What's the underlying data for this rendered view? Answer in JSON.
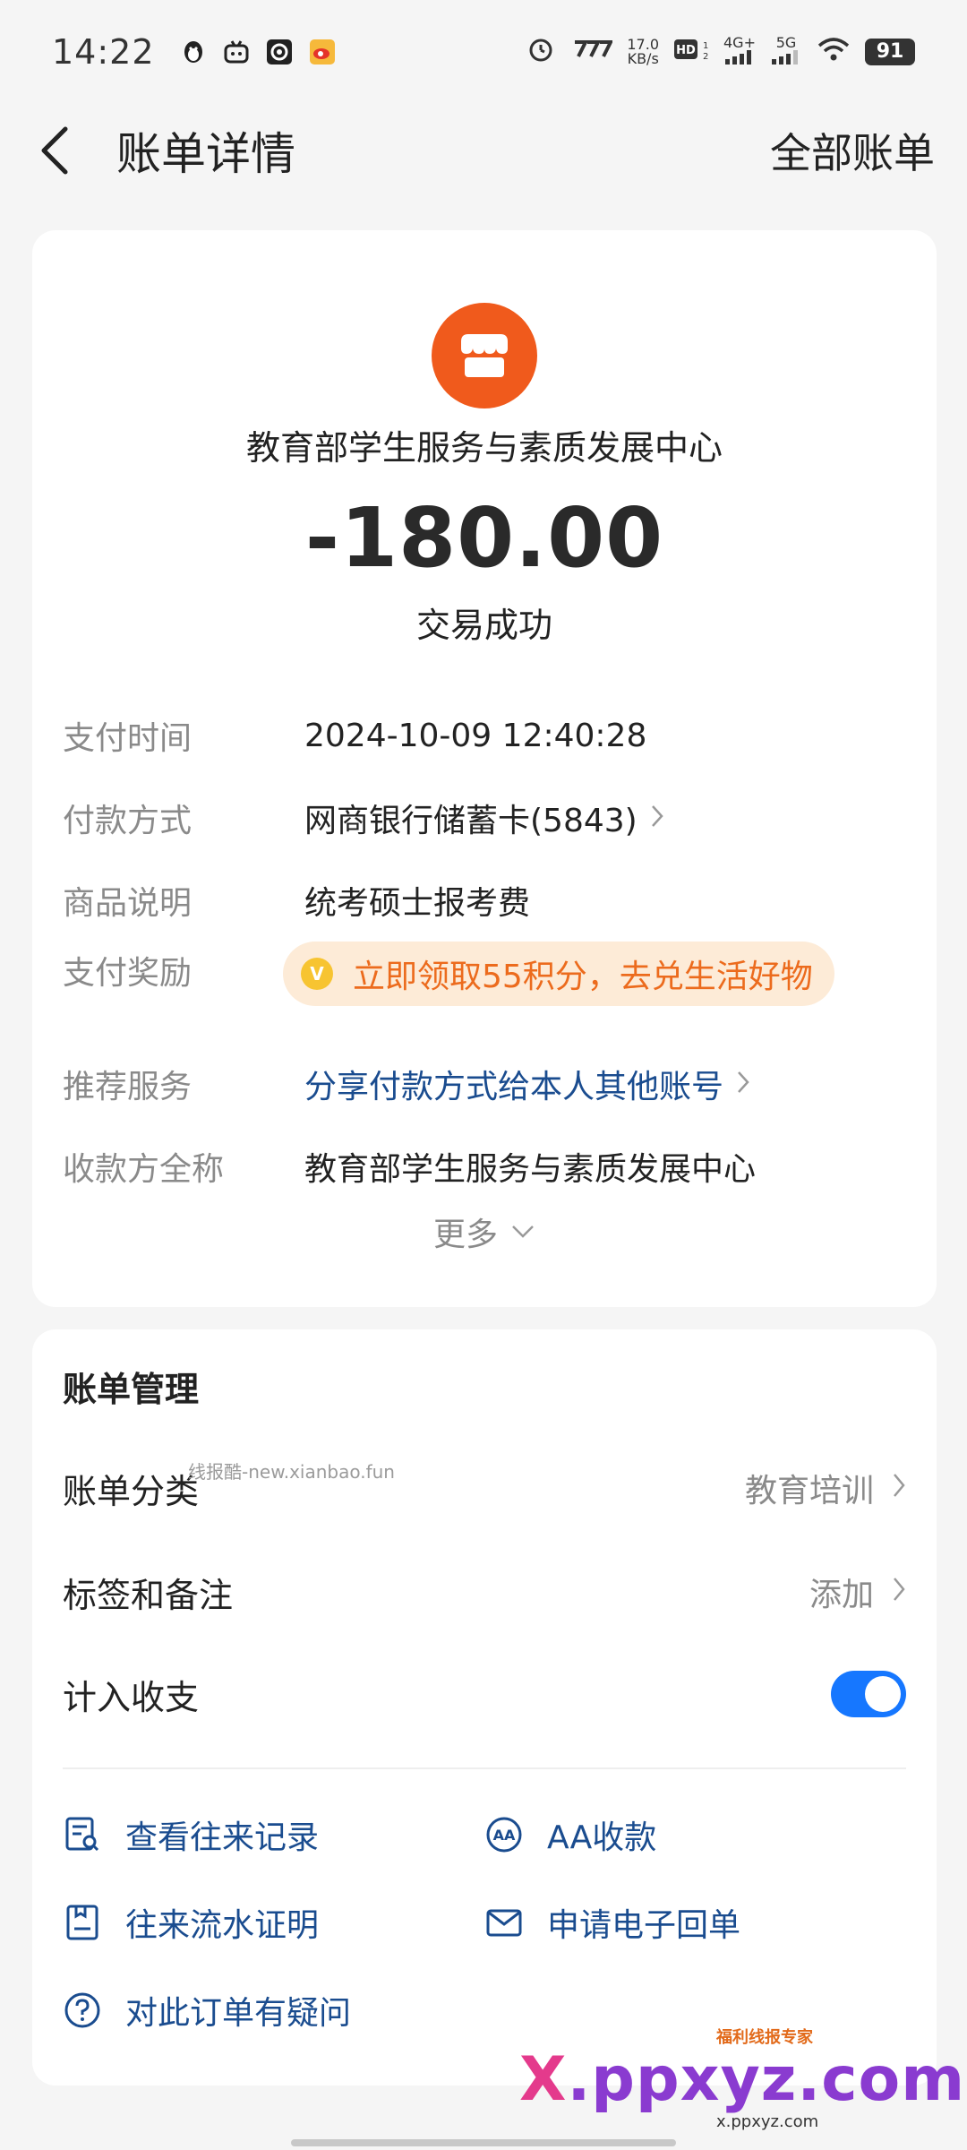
{
  "status_bar": {
    "time": "14:22",
    "speed": "17.0",
    "speed_unit": "KB/s",
    "network_4g": "4G+",
    "network_5g": "5G",
    "battery": "91"
  },
  "header": {
    "title": "账单详情",
    "all_bills": "全部账单"
  },
  "transaction": {
    "merchant": "教育部学生服务与素质发展中心",
    "amount": "-180.00",
    "status": "交易成功",
    "details": [
      {
        "label": "支付时间",
        "value": "2024-10-09 12:40:28"
      },
      {
        "label": "付款方式",
        "value": "网商银行储蓄卡(5843)"
      },
      {
        "label": "商品说明",
        "value": "统考硕士报考费"
      },
      {
        "label": "支付奖励",
        "value": "立即领取55积分，去兑生活好物"
      },
      {
        "label": "推荐服务",
        "value": "分享付款方式给本人其他账号"
      },
      {
        "label": "收款方全称",
        "value": "教育部学生服务与素质发展中心"
      }
    ],
    "more": "更多"
  },
  "manage": {
    "title": "账单管理",
    "category_label": "账单分类",
    "category_value": "教育培训",
    "tags_label": "标签和备注",
    "tags_value": "添加",
    "include_label": "计入收支",
    "include_on": true,
    "watermark": "线报酷-new.xianbao.fun",
    "actions": {
      "history": "查看往来记录",
      "aa": "AA收款",
      "proof": "往来流水证明",
      "receipt": "申请电子回单",
      "question": "对此订单有疑问"
    }
  },
  "brand": {
    "main_x": "X",
    "main_rest": ".ppxyz.com",
    "sub": "福利线报专家",
    "url": "x.ppxyz.com"
  },
  "colors": {
    "accent_blue": "#1677ff",
    "link_blue": "#1a4c8f",
    "merchant_orange": "#f05a1c",
    "reward_orange": "#ec6b1d"
  }
}
